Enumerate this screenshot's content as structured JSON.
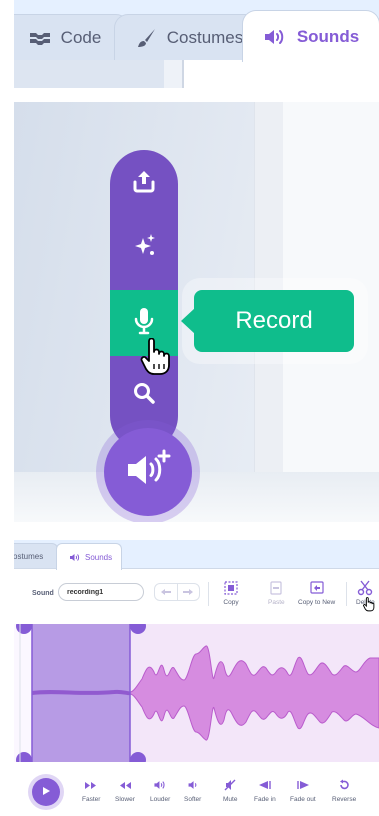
{
  "top_tabs": {
    "code": "Code",
    "costumes": "Costumes",
    "sounds": "Sounds"
  },
  "record_menu": {
    "items": [
      "upload-sound",
      "surprise",
      "record",
      "choose-sound"
    ],
    "tooltip": "Record"
  },
  "editor": {
    "tabs": {
      "costumes": "ostumes",
      "sounds": "Sounds"
    },
    "sound_label": "Sound",
    "sound_name": "recording1",
    "tools": {
      "copy": "Copy",
      "paste": "Paste",
      "copy_to_new": "Copy to New",
      "delete": "Delete"
    },
    "effects": {
      "faster": "Faster",
      "slower": "Slower",
      "louder": "Louder",
      "softer": "Softer",
      "mute": "Mute",
      "fade_in": "Fade in",
      "fade_out": "Fade out",
      "reverse": "Reverse"
    }
  },
  "colors": {
    "accent": "#855cd6",
    "menu": "#7551c2",
    "record_green": "#0fbd8c",
    "tab_bg": "#e5f0ff",
    "text": "#575e75"
  }
}
